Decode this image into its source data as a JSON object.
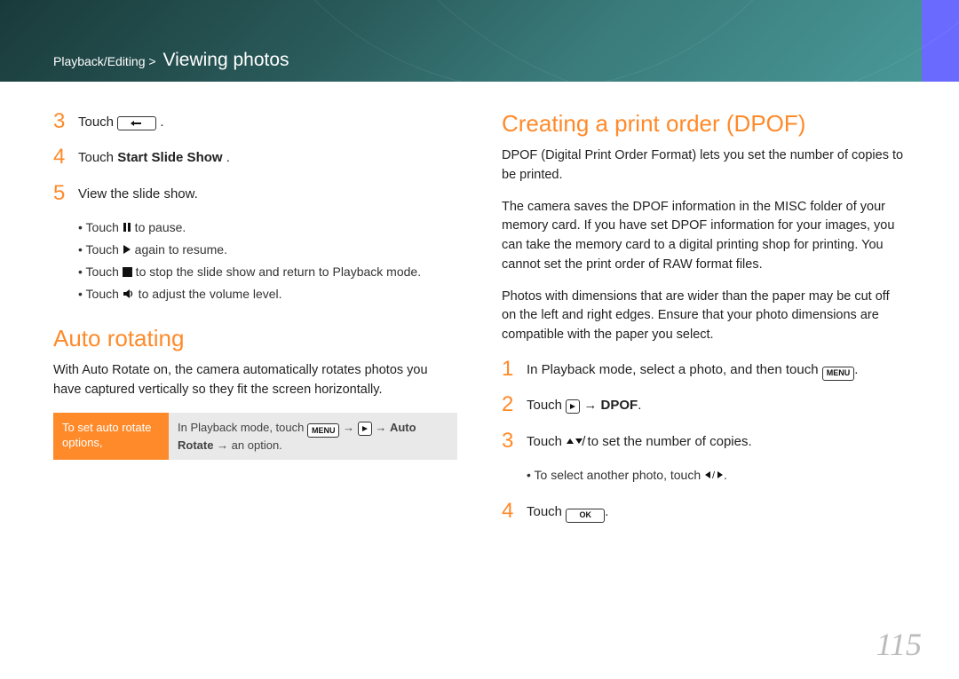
{
  "header": {
    "breadcrumb_section": "Playback/Editing >",
    "breadcrumb_current": "Viewing photos"
  },
  "left": {
    "step3_pre": "Touch ",
    "step3_post": ".",
    "step4_pre": "Touch ",
    "step4_bold": "Start Slide Show",
    "step4_post": ".",
    "step5": "View the slide show.",
    "sub1_pre": "Touch ",
    "sub1_post": " to pause.",
    "sub2_pre": "Touch ",
    "sub2_post": " again to resume.",
    "sub3_pre": "Touch ",
    "sub3_post": " to stop the slide show and return to Playback mode.",
    "sub4_pre": "Touch ",
    "sub4_post": " to adjust the volume level.",
    "auto_heading": "Auto rotating",
    "auto_para": "With Auto Rotate on, the camera automatically rotates photos you have captured vertically so they fit the screen horizontally.",
    "opt_label": "To set auto rotate options,",
    "opt_pre": "In Playback mode, touch ",
    "opt_arrow": " → ",
    "opt_bold": "Auto Rotate",
    "opt_post": " → an option."
  },
  "right": {
    "heading": "Creating a print order (DPOF)",
    "para1": "DPOF (Digital Print Order Format) lets you set the number of copies to be printed.",
    "para2": "The camera saves the DPOF information in the MISC folder of your memory card. If you have set DPOF information for your images, you can take the memory card to a digital printing shop for printing. You cannot set the print order of RAW format files.",
    "para3": "Photos with dimensions that are wider than the paper may be cut off on the left and right edges. Ensure that your photo dimensions are compatible with the paper you select.",
    "step1_pre": "In Playback mode, select a photo, and then touch ",
    "step1_post": ".",
    "step2_pre": "Touch ",
    "step2_arrow": " → ",
    "step2_bold": "DPOF",
    "step2_post": ".",
    "step3_pre": "Touch ",
    "step3_post": " to set the number of copies.",
    "step3_sub_pre": "To select another photo, touch ",
    "step3_sub_post": ".",
    "step4_pre": "Touch ",
    "step4_post": "."
  },
  "labels": {
    "menu": "MENU",
    "ok": "OK"
  },
  "page_number": "115"
}
